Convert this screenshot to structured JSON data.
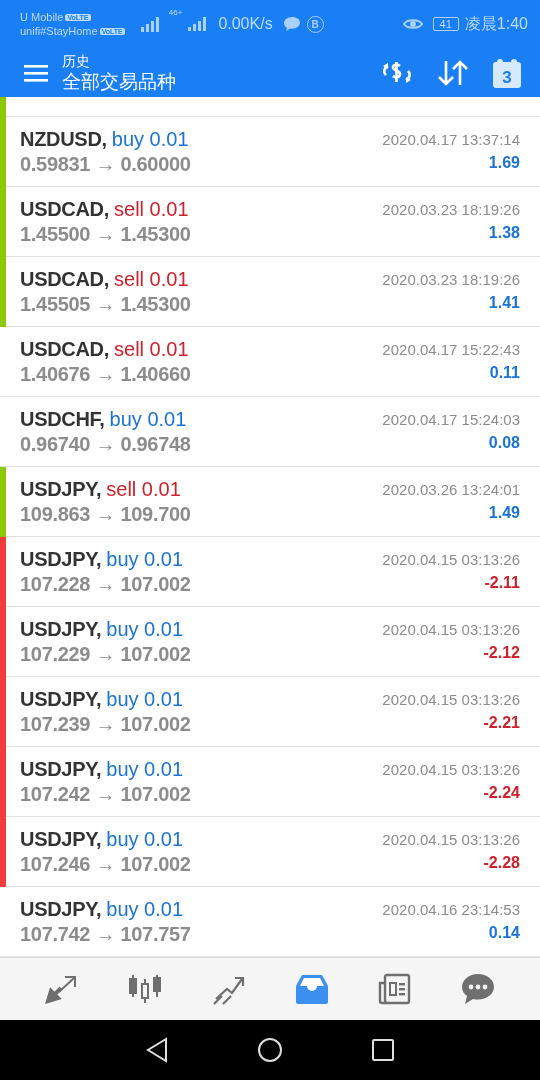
{
  "status_bar": {
    "carrier_1": "U Mobile",
    "carrier_2": "unifi#StayHome",
    "volte_1": "VoLTE",
    "volte_2": "VoLTE",
    "network": "46+",
    "speed": "0.00K/s",
    "b_badge": "B",
    "battery": "41",
    "time": "凌晨1:40"
  },
  "header": {
    "title": "历史",
    "subtitle": "全部交易品种",
    "calendar_day": "3"
  },
  "partial_row": {
    "color": "#8cc800"
  },
  "trades": [
    {
      "symbol": "NZDUSD,",
      "side": "buy",
      "volume": "0.01",
      "prices": "0.59831 → 0.60000",
      "time": "2020.04.17 13:37:14",
      "profit": "1.69",
      "color": "#8cc800"
    },
    {
      "symbol": "USDCAD,",
      "side": "sell",
      "volume": "0.01",
      "prices": "1.45500 → 1.45300",
      "time": "2020.03.23 18:19:26",
      "profit": "1.38",
      "color": "#8cc800"
    },
    {
      "symbol": "USDCAD,",
      "side": "sell",
      "volume": "0.01",
      "prices": "1.45505 → 1.45300",
      "time": "2020.03.23 18:19:26",
      "profit": "1.41",
      "color": "#8cc800"
    },
    {
      "symbol": "USDCAD,",
      "side": "sell",
      "volume": "0.01",
      "prices": "1.40676 → 1.40660",
      "time": "2020.04.17 15:22:43",
      "profit": "0.11"
    },
    {
      "symbol": "USDCHF,",
      "side": "buy",
      "volume": "0.01",
      "prices": "0.96740 → 0.96748",
      "time": "2020.04.17 15:24:03",
      "profit": "0.08"
    },
    {
      "symbol": "USDJPY,",
      "side": "sell",
      "volume": "0.01",
      "prices": "109.863 → 109.700",
      "time": "2020.03.26 13:24:01",
      "profit": "1.49",
      "color": "#8cc800"
    },
    {
      "symbol": "USDJPY,",
      "side": "buy",
      "volume": "0.01",
      "prices": "107.228 → 107.002",
      "time": "2020.04.15 03:13:26",
      "profit": "-2.11",
      "color": "#f03c3c"
    },
    {
      "symbol": "USDJPY,",
      "side": "buy",
      "volume": "0.01",
      "prices": "107.229 → 107.002",
      "time": "2020.04.15 03:13:26",
      "profit": "-2.12",
      "color": "#f03c3c"
    },
    {
      "symbol": "USDJPY,",
      "side": "buy",
      "volume": "0.01",
      "prices": "107.239 → 107.002",
      "time": "2020.04.15 03:13:26",
      "profit": "-2.21",
      "color": "#f03c3c"
    },
    {
      "symbol": "USDJPY,",
      "side": "buy",
      "volume": "0.01",
      "prices": "107.242 → 107.002",
      "time": "2020.04.15 03:13:26",
      "profit": "-2.24",
      "color": "#f03c3c"
    },
    {
      "symbol": "USDJPY,",
      "side": "buy",
      "volume": "0.01",
      "prices": "107.246 → 107.002",
      "time": "2020.04.15 03:13:26",
      "profit": "-2.28",
      "color": "#f03c3c"
    },
    {
      "symbol": "USDJPY,",
      "side": "buy",
      "volume": "0.01",
      "prices": "107.742 → 107.757",
      "time": "2020.04.16 23:14:53",
      "profit": "0.14"
    }
  ],
  "bottom_nav": [
    {
      "kind": "quotes",
      "selected": false
    },
    {
      "kind": "chart",
      "selected": false
    },
    {
      "kind": "trade",
      "selected": false
    },
    {
      "kind": "history",
      "selected": true
    },
    {
      "kind": "news",
      "selected": false
    },
    {
      "kind": "chat",
      "selected": false
    }
  ]
}
